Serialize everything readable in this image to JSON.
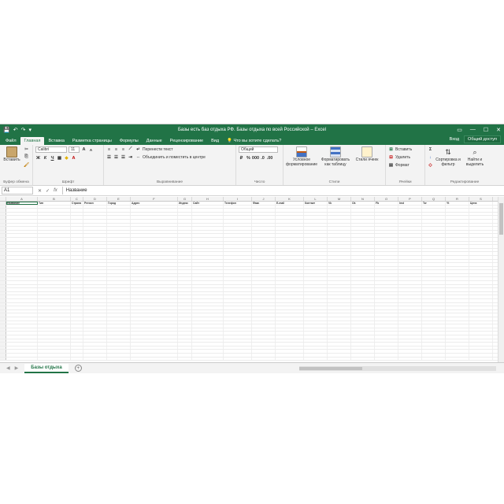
{
  "window": {
    "title": "Базы есть бaз отдыха РФ. Базы отдыха по всей Российской – Excel",
    "quick_access": [
      "💾",
      "↶",
      "↷",
      "▾"
    ],
    "controls": [
      "▭",
      "—",
      "☐",
      "✕"
    ]
  },
  "tabs": {
    "items": [
      "Файл",
      "Главная",
      "Вставка",
      "Разметка страницы",
      "Формулы",
      "Данные",
      "Рецензирование",
      "Вид"
    ],
    "active_index": 1,
    "tell_me": "Что вы хотите сделать?",
    "signin": "Вход",
    "share": "Общий доступ"
  },
  "ribbon": {
    "clipboard": {
      "paste": "Вставить",
      "name": "Буфер обмена"
    },
    "font": {
      "family": "Calibri",
      "size": "11",
      "bold": "Ж",
      "italic": "К",
      "underline": "Ч",
      "name": "Шрифт"
    },
    "alignment": {
      "wrap": "Перенести текст",
      "merge": "Объединить и поместить в центре",
      "name": "Выравнивание"
    },
    "number": {
      "format": "Общий",
      "name": "Число"
    },
    "styles": {
      "conditional": "Условное форматирование",
      "table": "Форматировать как таблицу",
      "cell": "Стили ячеек",
      "name": "Стили"
    },
    "cells": {
      "insert": "Вставить",
      "delete": "Удалить",
      "format": "Формат",
      "name": "Ячейки"
    },
    "editing": {
      "sort": "Сортировка и фильтр",
      "find": "Найти и выделить",
      "name": "Редактирование"
    }
  },
  "formula_bar": {
    "name_box": "A1",
    "cancel": "✕",
    "enter": "✓",
    "fx": "fx",
    "content": "Название"
  },
  "grid": {
    "column_letters": [
      "A",
      "B",
      "C",
      "D",
      "E",
      "F",
      "G",
      "H",
      "I",
      "J",
      "K",
      "L",
      "M",
      "N",
      "O",
      "P",
      "Q",
      "R",
      "S"
    ],
    "header_row": [
      "Название",
      "Тип",
      "Страна",
      "Регион",
      "Город",
      "Адрес",
      "Индекс",
      "Сайт",
      "Телефон",
      "Факс",
      "E-mail",
      "Контакт",
      "Vk",
      "Ok",
      "Fb",
      "Inst",
      "Tw",
      "Yt",
      "Цена"
    ]
  },
  "sheets": {
    "active": "Базы отдыха",
    "add": "+"
  }
}
